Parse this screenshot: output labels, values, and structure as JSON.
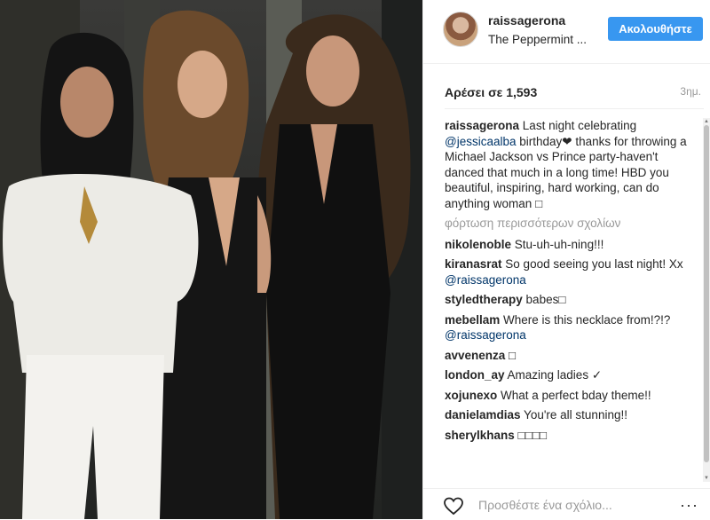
{
  "post": {
    "username": "raissagerona",
    "location": "The Peppermint ...",
    "follow_label": "Ακολουθήστε",
    "likes": "Αρέσει σε 1,593",
    "time": "3ημ."
  },
  "caption": {
    "user": "raissagerona",
    "text_1": " Last night celebrating ",
    "mention": "@jessicaalba",
    "text_2": " birthday❤ thanks for throwing a Michael Jackson vs Prince party-haven't danced that much in a long time! HBD you beautiful, inspiring, hard working, can do anything woman ",
    "emoji": "□"
  },
  "load_more": "φόρτωση περισσότερων σχολίων",
  "comments": [
    {
      "user": "nikolenoble",
      "text": " Stu-uh-uh-ning!!!",
      "mention": "",
      "tail": ""
    },
    {
      "user": "kiranasrat",
      "text": " So good seeing you last night! Xx ",
      "mention": "@raissagerona",
      "tail": ""
    },
    {
      "user": "styledtherapy",
      "text": " babes□",
      "mention": "",
      "tail": ""
    },
    {
      "user": "mebellam",
      "text": " Where is this necklace from!?!? ",
      "mention": "@raissagerona",
      "tail": ""
    },
    {
      "user": "avvenenza",
      "text": " □",
      "mention": "",
      "tail": ""
    },
    {
      "user": "london_ay",
      "text": " Amazing ladies ✓",
      "mention": "",
      "tail": ""
    },
    {
      "user": "xojunexo",
      "text": " What a perfect bday theme!!",
      "mention": "",
      "tail": ""
    },
    {
      "user": "danielamdias",
      "text": " You're all stunning!!",
      "mention": "",
      "tail": ""
    },
    {
      "user": "sherylkhans",
      "text": " □□□□",
      "mention": "",
      "tail": ""
    }
  ],
  "footer": {
    "placeholder": "Προσθέστε ένα σχόλιο...",
    "more": "···"
  },
  "colors": {
    "accent": "#3897f0",
    "mention": "#003569"
  },
  "icons": [
    "heart-icon",
    "more-options-icon"
  ]
}
